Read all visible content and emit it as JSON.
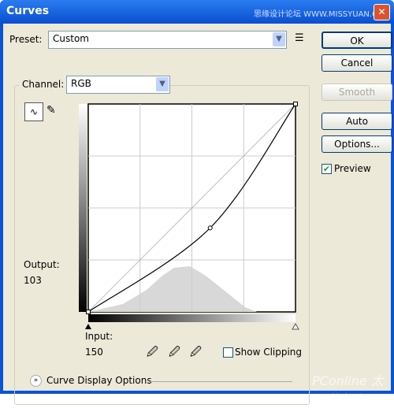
{
  "window": {
    "title": "Curves",
    "watermark": "思缘设计论坛 WWW.MISSYUAN.COM",
    "close": "✕"
  },
  "preset": {
    "label": "Preset:",
    "value": "Custom",
    "menu_icon": "list-menu-icon"
  },
  "channel": {
    "label": "Channel:",
    "value": "RGB"
  },
  "buttons": {
    "ok": "OK",
    "cancel": "Cancel",
    "smooth": "Smooth",
    "auto": "Auto",
    "options": "Options..."
  },
  "preview": {
    "label": "Preview",
    "checked": true
  },
  "output": {
    "label": "Output:",
    "value": "103"
  },
  "input": {
    "label": "Input:",
    "value": "150"
  },
  "show_clipping": {
    "label": "Show Clipping",
    "checked": false
  },
  "curve_display_options": "Curve Display Options",
  "corner_watermark": "PConline 太平洋电脑网",
  "chart_data": {
    "type": "line",
    "xlim": [
      0,
      255
    ],
    "ylim": [
      0,
      255
    ],
    "grid": true,
    "points": [
      [
        0,
        0
      ],
      [
        150,
        103
      ],
      [
        255,
        255
      ]
    ],
    "selected_point": [
      150,
      103
    ]
  }
}
